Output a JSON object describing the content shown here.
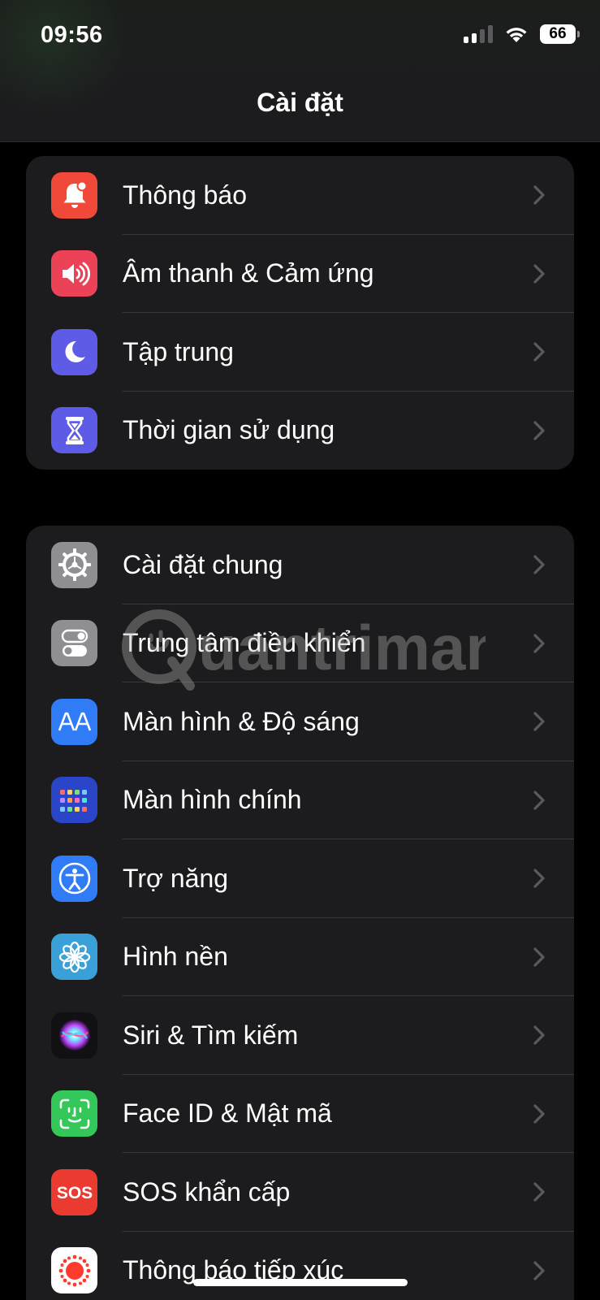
{
  "status_bar": {
    "time": "09:56",
    "battery": "66",
    "icons": [
      "cellular-signal-icon",
      "wifi-icon",
      "battery-icon"
    ]
  },
  "nav": {
    "title": "Cài đặt"
  },
  "groups": [
    {
      "items": [
        {
          "label": "Thông báo",
          "icon": "bell-icon",
          "color": "#f0493a"
        },
        {
          "label": "Âm thanh & Cảm ứng",
          "icon": "speaker-icon",
          "color": "#eb4258"
        },
        {
          "label": "Tập trung",
          "icon": "moon-icon",
          "color": "#5e5ce6"
        },
        {
          "label": "Thời gian sử dụng",
          "icon": "hourglass-icon",
          "color": "#5e5ce6"
        }
      ]
    },
    {
      "items": [
        {
          "label": "Cài đặt chung",
          "icon": "gear-icon",
          "color": "#8e8e93"
        },
        {
          "label": "Trung tâm điều khiển",
          "icon": "toggles-icon",
          "color": "#8e8e93"
        },
        {
          "label": "Màn hình & Độ sáng",
          "icon": "text-size-icon",
          "color": "#2f7cf6"
        },
        {
          "label": "Màn hình chính",
          "icon": "home-grid-icon",
          "color": "#2a45c8"
        },
        {
          "label": "Trợ năng",
          "icon": "accessibility-icon",
          "color": "#2f7cf6"
        },
        {
          "label": "Hình nền",
          "icon": "flower-icon",
          "color": "#3aa1d8"
        },
        {
          "label": "Siri & Tìm kiếm",
          "icon": "siri-icon",
          "color": "#111114"
        },
        {
          "label": "Face ID & Mật mã",
          "icon": "face-id-icon",
          "color": "#34c759"
        },
        {
          "label": "SOS khẩn cấp",
          "icon": "sos-icon",
          "color": "#eb3b30"
        },
        {
          "label": "Thông báo tiếp xúc",
          "icon": "exposure-icon",
          "color": "#ffffff"
        }
      ]
    }
  ],
  "colors": {
    "background": "#000000",
    "group_background": "#1c1c1e",
    "separator": "#38383a",
    "chevron": "#5a5a5e",
    "text": "#ffffff"
  },
  "watermark": "uantrimang"
}
